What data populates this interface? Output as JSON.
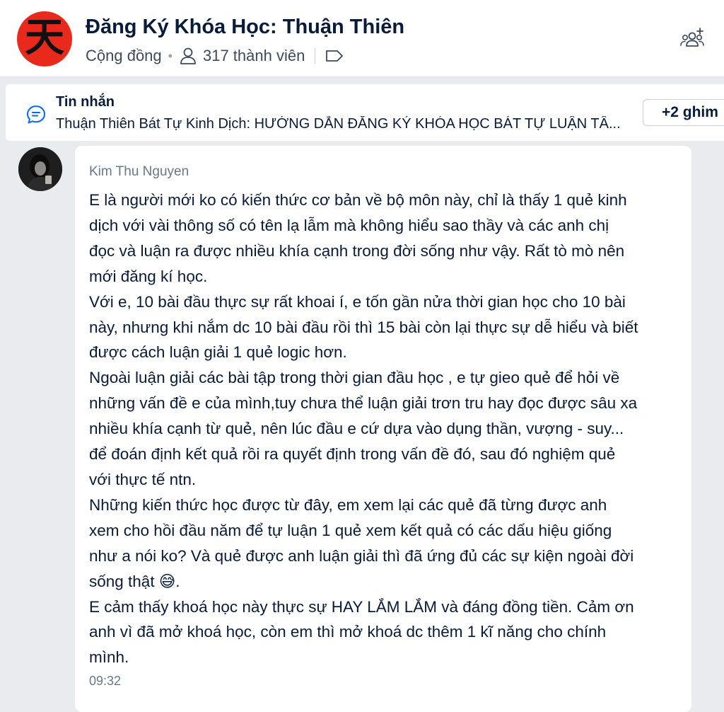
{
  "header": {
    "logo_char": "天",
    "title": "Đăng Ký Khóa Học: Thuận Thiên",
    "community_label": "Cộng đồng",
    "member_count": "317 thành viên"
  },
  "pinned": {
    "label": "Tin nhắn",
    "text": "Thuận Thiên Bát Tự Kinh Dịch: HƯỚNG DẪN ĐĂNG KÝ KHÓA HỌC BÁT TỰ LUẬN TÂ...",
    "more_label": "+2 ghim"
  },
  "message": {
    "sender": "Kim Thu Nguyen",
    "lines": [
      "E là người mới ko có kiến thức cơ bản về bộ môn này, chỉ là thấy 1 quẻ kinh",
      "dịch với vài thông số có tên lạ lẫm mà không hiểu sao thầy và các anh chị",
      "đọc và luận ra được nhiều khía cạnh trong đời sống như vậy. Rất tò mò nên",
      "mới đăng kí học.",
      "Với e, 10 bài đầu thực sự rất khoai í, e tốn gần nửa thời gian học cho 10 bài",
      "này, nhưng khi nắm dc 10 bài đầu rồi thì 15 bài còn lại thực sự dễ hiểu và biết",
      "được cách luận giải 1 quẻ  logic hơn.",
      "Ngoài luận giải các bài tập trong thời gian đầu học , e tự gieo quẻ để hỏi về",
      "những vấn đề e của mình,tuy chưa thể luận giải trơn tru hay đọc được sâu xa",
      "nhiều khía cạnh từ quẻ, nên lúc đầu e cứ dựa vào dụng thần, vượng - suy...",
      "để đoán định kết quả rồi ra quyết định trong vấn đề đó, sau đó nghiệm quẻ",
      "với thực tế ntn.",
      "Những kiến thức học được từ đây, em xem lại các quẻ đã từng được anh",
      "xem cho hồi đầu năm để tự luận 1 quẻ xem kết quả có các dấu hiệu giống",
      "như a nói ko? Và quẻ được anh luận giải thì đã ứng đủ các sự kiện ngoài đời",
      "sống thật 😅.",
      "E cảm thấy khoá học này thực sự HAY LẮM LẮM và đáng đồng tiền. Cảm ơn",
      "anh vì đã mở khoá học, còn em thì mở khoá dc thêm 1 kĩ năng cho chính",
      "mình."
    ],
    "time": "09:32"
  },
  "colors": {
    "background": "#e9ebee",
    "text": "#081b3a",
    "secondary_text": "#6b7686",
    "logo_red": "#e8291c",
    "chat_icon_blue": "#0068ff"
  }
}
